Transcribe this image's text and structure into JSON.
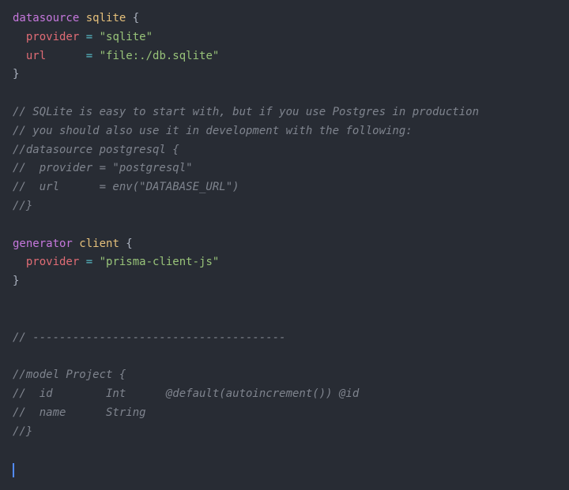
{
  "code": {
    "datasource": {
      "keyword": "datasource",
      "name": "sqlite",
      "open": " {",
      "provider_key": "provider",
      "provider_eq": " = ",
      "provider_val": "\"sqlite\"",
      "url_key": "url",
      "url_eq": "      = ",
      "url_val": "\"file:./db.sqlite\"",
      "close": "}"
    },
    "comments": {
      "c1": "// SQLite is easy to start with, but if you use Postgres in production",
      "c2": "// you should also use it in development with the following:",
      "c3": "//datasource postgresql {",
      "c4": "//  provider = \"postgresql\"",
      "c5": "//  url      = env(\"DATABASE_URL\")",
      "c6": "//}",
      "divider": "// --------------------------------------",
      "m1": "//model Project {",
      "m2": "//  id        Int      @default(autoincrement()) @id",
      "m3": "//  name      String",
      "m4": "//}"
    },
    "generator": {
      "keyword": "generator",
      "name": "client",
      "open": " {",
      "provider_key": "provider",
      "provider_eq": " = ",
      "provider_val": "\"prisma-client-js\"",
      "close": "}"
    }
  }
}
